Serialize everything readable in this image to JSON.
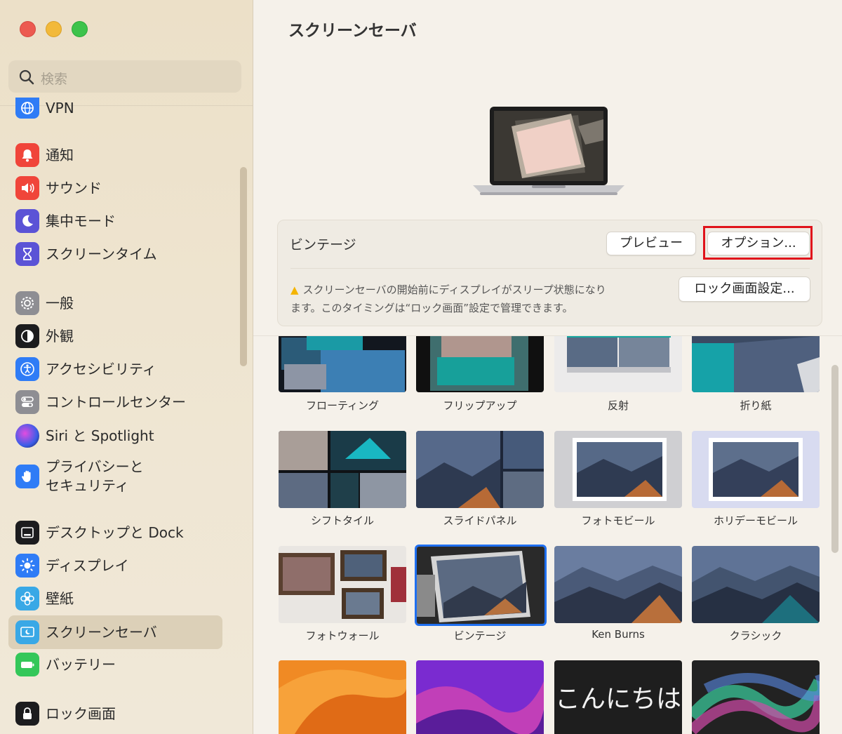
{
  "sidebar": {
    "search_placeholder": "検索",
    "items": [
      {
        "label": "VPN",
        "icon": "globe-icon",
        "color": "#2f7cf6"
      },
      {
        "label": "通知",
        "icon": "bell-icon",
        "color": "#f0453a"
      },
      {
        "label": "サウンド",
        "icon": "speaker-icon",
        "color": "#f0453a"
      },
      {
        "label": "集中モード",
        "icon": "moon-icon",
        "color": "#5b53d6"
      },
      {
        "label": "スクリーンタイム",
        "icon": "hourglass-icon",
        "color": "#5b53d6"
      },
      {
        "label": "一般",
        "icon": "gear-icon",
        "color": "#8e8e93"
      },
      {
        "label": "外観",
        "icon": "appearance-icon",
        "color": "#1c1c1e"
      },
      {
        "label": "アクセシビリティ",
        "icon": "accessibility-icon",
        "color": "#2f7cf6"
      },
      {
        "label": "コントロールセンター",
        "icon": "toggles-icon",
        "color": "#8e8e93"
      },
      {
        "label": "Siri と Spotlight",
        "icon": "siri-icon",
        "color": "#7b3bd1"
      },
      {
        "label": "プライバシーと\nセキュリティ",
        "icon": "hand-icon",
        "color": "#2f7cf6"
      },
      {
        "label": "デスクトップと Dock",
        "icon": "dock-icon",
        "color": "#1c1c1e"
      },
      {
        "label": "ディスプレイ",
        "icon": "sun-icon",
        "color": "#2f7cf6"
      },
      {
        "label": "壁紙",
        "icon": "flower-icon",
        "color": "#39a8e6"
      },
      {
        "label": "スクリーンセーバ",
        "icon": "screensaver-icon",
        "color": "#39a8e6",
        "selected": true
      },
      {
        "label": "バッテリー",
        "icon": "battery-icon",
        "color": "#34c759"
      },
      {
        "label": "ロック画面",
        "icon": "lock-icon",
        "color": "#1c1c1e"
      }
    ]
  },
  "main": {
    "title": "スクリーンセーバ",
    "selected_saver": "ビンテージ",
    "preview_button": "プレビュー",
    "options_button": "オプション...",
    "lock_button": "ロック画面設定...",
    "warning_line1": "スクリーンセーバの開始前にディスプレイがスリープ状態になり",
    "warning_line2": "ます。このタイミングは“ロック画面”設定で管理できます。",
    "highlight_color": "#e0131b",
    "savers": [
      {
        "label": "フローティング"
      },
      {
        "label": "フリップアップ"
      },
      {
        "label": "反射"
      },
      {
        "label": "折り紙"
      },
      {
        "label": "シフトタイル"
      },
      {
        "label": "スライドパネル"
      },
      {
        "label": "フォトモビール"
      },
      {
        "label": "ホリデーモビール"
      },
      {
        "label": "フォトウォール"
      },
      {
        "label": "ビンテージ",
        "selected": true
      },
      {
        "label": "Ken Burns"
      },
      {
        "label": "クラシック"
      },
      {
        "label": ""
      },
      {
        "label": ""
      },
      {
        "label": "こんにちは"
      },
      {
        "label": ""
      }
    ]
  }
}
